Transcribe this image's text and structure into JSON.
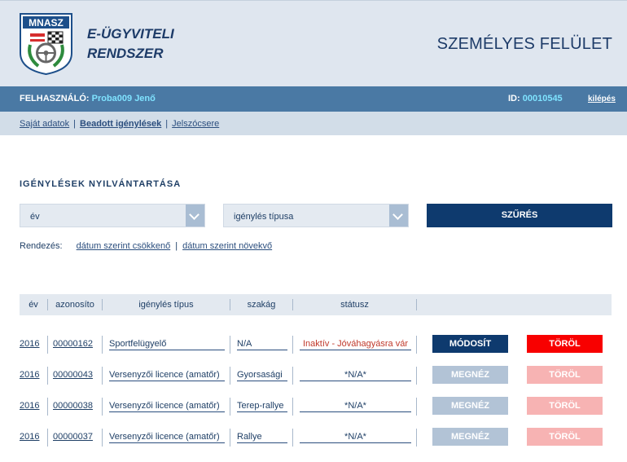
{
  "header": {
    "logo_text": "MNASZ",
    "title_line1": "E-ÜGYVITELI",
    "title_line2": "RENDSZER",
    "personal_area": "SZEMÉLYES FELÜLET"
  },
  "userbar": {
    "user_label": "FELHASZNÁLÓ:",
    "user_name": "Proba009 Jenő",
    "id_label": "ID:",
    "id_value": "00010545",
    "logout": "kilépés"
  },
  "nav": {
    "items": [
      {
        "label": "Saját adatok",
        "active": false
      },
      {
        "label": "Beadott igénylések",
        "active": true
      },
      {
        "label": "Jelszócsere",
        "active": false
      }
    ],
    "separator": "|"
  },
  "section_title": "IGÉNYLÉSEK NYILVÁNTARTÁSA",
  "filters": {
    "year_select": "év",
    "type_select": "igénylés típusa",
    "filter_button": "SZŰRÉS"
  },
  "sort": {
    "label": "Rendezés:",
    "desc": "dátum szerint csökkenő",
    "separator": "|",
    "asc": "dátum szerint növekvő"
  },
  "table": {
    "columns": [
      "év",
      "azonosíto",
      "igénylés típus",
      "szakág",
      "státusz"
    ],
    "rows": [
      {
        "year": "2016",
        "id": "00000162",
        "type": "Sportfelügyelő",
        "branch": "N/A",
        "status": "Inaktív - Jóváhagyásra vár",
        "action": "MÓDOSÍT",
        "delete": "TÖRÖL",
        "editable": true
      },
      {
        "year": "2016",
        "id": "00000043",
        "type": "Versenyzői licence (amatőr)",
        "branch": "Gyorsasági",
        "status": "*N/A*",
        "action": "MEGNÉZ",
        "delete": "TÖRÖL",
        "editable": false
      },
      {
        "year": "2016",
        "id": "00000038",
        "type": "Versenyzői licence (amatőr)",
        "branch": "Terep-rallye",
        "status": "*N/A*",
        "action": "MEGNÉZ",
        "delete": "TÖRÖL",
        "editable": false
      },
      {
        "year": "2016",
        "id": "00000037",
        "type": "Versenyzői licence (amatőr)",
        "branch": "Rallye",
        "status": "*N/A*",
        "action": "MEGNÉZ",
        "delete": "TÖRÖL",
        "editable": false
      }
    ]
  }
}
